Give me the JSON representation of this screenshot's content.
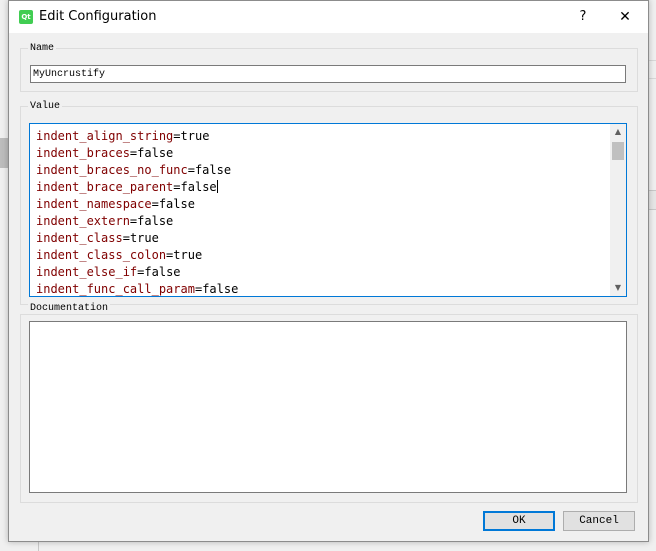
{
  "dialog": {
    "title": "Edit Configuration",
    "app_icon_label": "Qt",
    "help_label": "?",
    "close_label": "✕"
  },
  "name_group": {
    "label": "Name",
    "value": "MyUncrustify"
  },
  "value_group": {
    "label": "Value",
    "lines": [
      {
        "key": "indent_align_string",
        "eq": "=",
        "value": "true"
      },
      {
        "key": "indent_braces",
        "eq": "=",
        "value": "false"
      },
      {
        "key": "indent_braces_no_func",
        "eq": "=",
        "value": "false"
      },
      {
        "key": "indent_brace_parent",
        "eq": "=",
        "value": "false"
      },
      {
        "key": "indent_namespace",
        "eq": "=",
        "value": "false"
      },
      {
        "key": "indent_extern",
        "eq": "=",
        "value": "false"
      },
      {
        "key": "indent_class",
        "eq": "=",
        "value": "true"
      },
      {
        "key": "indent_class_colon",
        "eq": "=",
        "value": "true"
      },
      {
        "key": "indent_else_if",
        "eq": "=",
        "value": "false"
      },
      {
        "key": "indent_func_call_param",
        "eq": "=",
        "value": "false"
      }
    ],
    "scroll_up": "▲",
    "scroll_down": "▼"
  },
  "documentation": {
    "label": "Documentation",
    "text": ""
  },
  "buttons": {
    "ok": "OK",
    "cancel": "Cancel"
  },
  "colors": {
    "key": "#800000",
    "focus_border": "#0078d7"
  }
}
